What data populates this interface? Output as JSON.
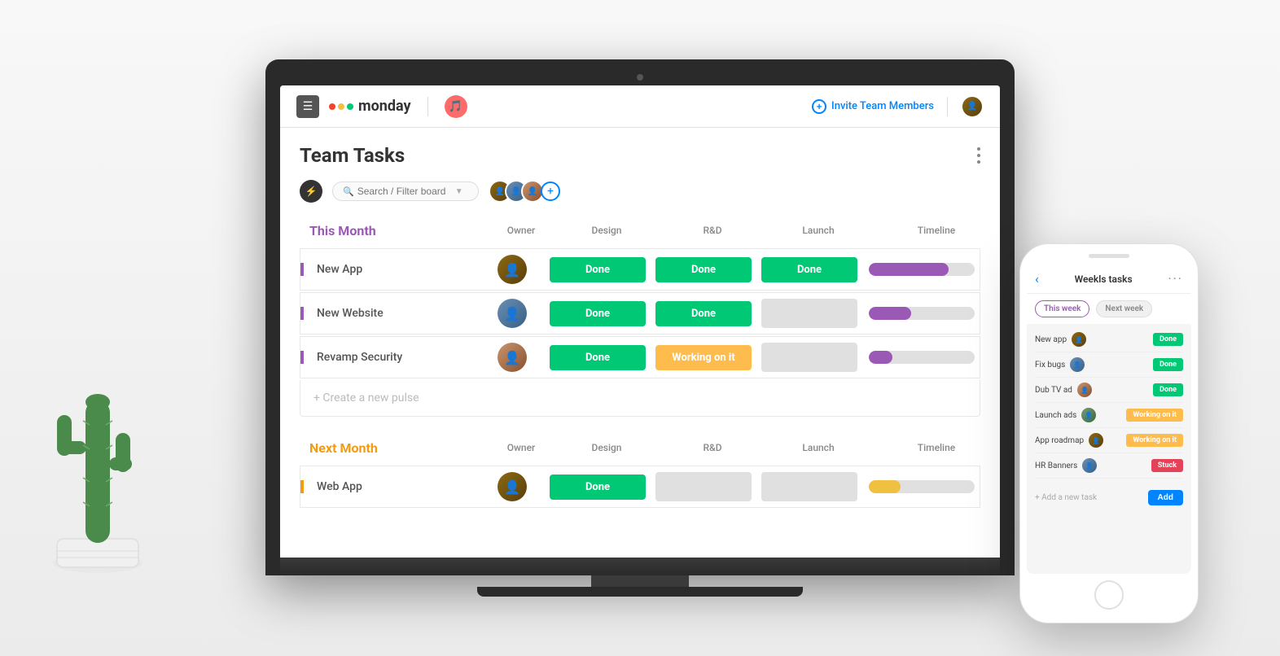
{
  "header": {
    "logo_text": "monday",
    "invite_label": "Invite Team Members",
    "menu_btn": "☰"
  },
  "board": {
    "title": "Team Tasks",
    "search_placeholder": "Search / Filter board",
    "columns": [
      "Owner",
      "Design",
      "R&D",
      "Launch",
      "Timeline"
    ]
  },
  "groups": [
    {
      "title": "This Month",
      "color": "purple",
      "tasks": [
        {
          "name": "New App",
          "design": "Done",
          "rnd": "Done",
          "launch": "Done",
          "timeline_fill": 75
        },
        {
          "name": "New Website",
          "design": "Done",
          "rnd": "Done",
          "launch": "",
          "timeline_fill": 45
        },
        {
          "name": "Revamp Security",
          "design": "Done",
          "rnd": "Working on it",
          "launch": "",
          "timeline_fill": 25
        }
      ],
      "create_pulse": "+ Create a new pulse"
    },
    {
      "title": "Next Month",
      "color": "orange",
      "tasks": [
        {
          "name": "Web App",
          "design": "Done",
          "rnd": "",
          "launch": "",
          "timeline_fill": 30,
          "timeline_color": "yellow"
        }
      ]
    }
  ],
  "phone": {
    "title": "Weekls tasks",
    "tab_this_week": "This week",
    "tab_next_week": "Next week",
    "tasks": [
      {
        "name": "New app",
        "status": "Done",
        "status_type": "done"
      },
      {
        "name": "Fix bugs",
        "status": "Done",
        "status_type": "done"
      },
      {
        "name": "Dub TV ad",
        "status": "Done",
        "status_type": "done"
      },
      {
        "name": "Launch ads",
        "status": "Working on it",
        "status_type": "working"
      },
      {
        "name": "App roadmap",
        "status": "Working on it",
        "status_type": "working"
      },
      {
        "name": "HR Banners",
        "status": "Stuck",
        "status_type": "stuck"
      }
    ],
    "add_task_placeholder": "+ Add a new task",
    "add_btn": "Add"
  }
}
